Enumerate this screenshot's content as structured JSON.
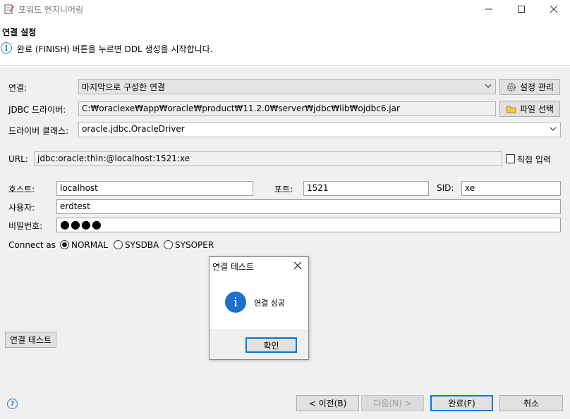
{
  "window": {
    "title": "포워드 엔지니어링",
    "icon": "edit-document-icon"
  },
  "header": {
    "title": "연결 설정",
    "message": "완료 (FINISH) 버튼을 누르면 DDL 생성을 시작합니다."
  },
  "form": {
    "connection": {
      "label": "연결:",
      "value": "마지막으로 구성한 연결",
      "button": "설정 관리"
    },
    "jdbc_driver": {
      "label": "JDBC 드라이버:",
      "value": "C:₩oraclexe₩app₩oracle₩product₩11.2.0₩server₩jdbc₩lib₩ojdbc6.jar",
      "button": "파일 선택"
    },
    "driver_class": {
      "label": "드라이버 클래스:",
      "value": "oracle.jdbc.OracleDriver"
    },
    "url": {
      "label": "URL:",
      "value": "jdbc:oracle:thin:@localhost:1521:xe",
      "direct_input_label": "직접 입력",
      "direct_input_checked": false
    },
    "host": {
      "label": "호스트:",
      "value": "localhost"
    },
    "port": {
      "label": "포트:",
      "value": "1521"
    },
    "sid": {
      "label": "SID:",
      "value": "xe"
    },
    "user": {
      "label": "사용자:",
      "value": "erdtest"
    },
    "password": {
      "label": "비밀번호:",
      "value": "●●●●"
    },
    "connect_as": {
      "label": "Connect as",
      "options": [
        "NORMAL",
        "SYSDBA",
        "SYSOPER"
      ],
      "selected": "NORMAL"
    },
    "test_button": "연결 테스트"
  },
  "footer": {
    "back": "< 이전(B)",
    "next": "다음(N) >",
    "finish": "완료(F)",
    "cancel": "취소"
  },
  "dialog": {
    "title": "연결 테스트",
    "message": "연결 성공",
    "ok": "확인"
  }
}
